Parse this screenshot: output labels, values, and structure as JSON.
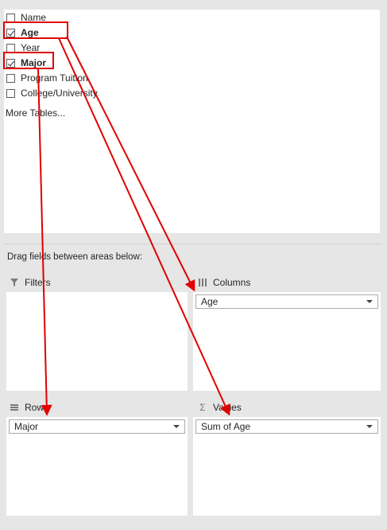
{
  "fields": [
    {
      "label": "Name",
      "checked": false,
      "bold": false
    },
    {
      "label": "Age",
      "checked": true,
      "bold": true
    },
    {
      "label": "Year",
      "checked": false,
      "bold": false
    },
    {
      "label": "Major",
      "checked": true,
      "bold": true
    },
    {
      "label": "Program Tuition",
      "checked": false,
      "bold": false
    },
    {
      "label": "College/University",
      "checked": false,
      "bold": false
    }
  ],
  "more_tables": "More Tables...",
  "drag_hint": "Drag fields between areas below:",
  "areas": {
    "filters": {
      "label": "Filters",
      "icon": "filter-icon"
    },
    "columns": {
      "label": "Columns",
      "icon": "columns-icon",
      "field": "Age"
    },
    "rows": {
      "label": "Rows",
      "icon": "rows-icon",
      "field": "Major"
    },
    "values": {
      "label": "Values",
      "icon": "sigma-icon",
      "field": "Sum of Age"
    }
  },
  "annotation_color": "#e00000"
}
